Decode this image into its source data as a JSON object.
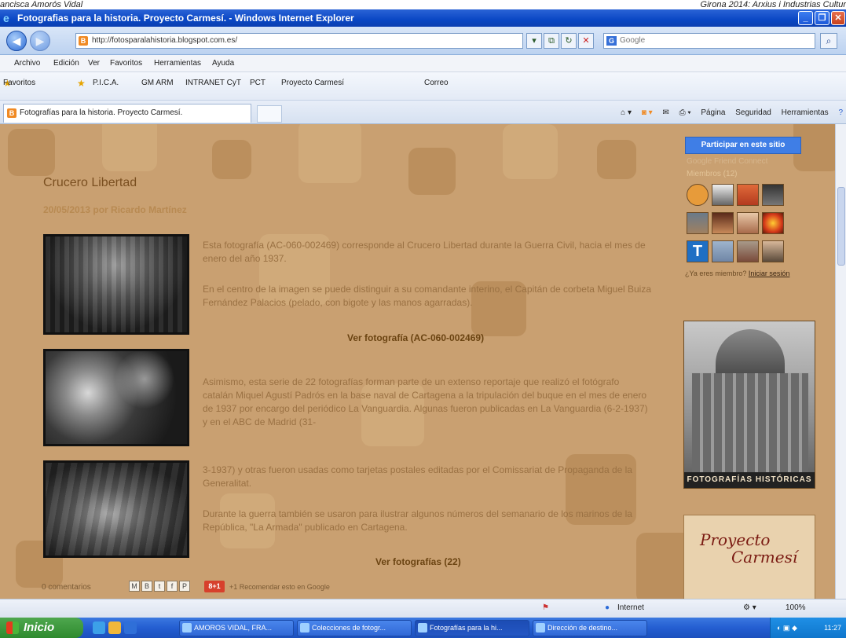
{
  "caption": {
    "left": "ancisca Amorós Vidal",
    "right": "Girona 2014: Arxius i Industrias Cultur"
  },
  "window": {
    "title": "Fotografias para la historia. Proyecto Carmesí. - Windows Internet Explorer"
  },
  "address": {
    "url": "http://fotosparalahistoria.blogspot.com.es/",
    "search_placeholder": "Google"
  },
  "menu": [
    "Archivo",
    "Edición",
    "Ver",
    "Favoritos",
    "Herramientas",
    "Ayuda"
  ],
  "favorites": {
    "label": "Favoritos",
    "items": [
      "P.I.C.A.",
      "GM ARM",
      "INTRANET CyT",
      "PCT",
      "Proyecto Carmesí",
      "Correo"
    ]
  },
  "tab": {
    "label": "Fotografías para la historia. Proyecto Carmesí."
  },
  "commandbar": [
    "Página",
    "Seguridad",
    "Herramientas"
  ],
  "post": {
    "title": "Crucero Libertad",
    "meta": "20/05/2013 por Ricardo Martínez",
    "para1": "Esta fotografía (AC-060-002469) corresponde al Crucero Libertad durante la Guerra Civil, hacia el mes de enero del año 1937.",
    "para2": "En el centro de la imagen se puede distinguir a su comandante interino, el Capitán de corbeta Miguel Buiza Fernández Palacios (pelado, con bigote y las manos agarradas).",
    "link1": "Ver fotografía (AC-060-002469)",
    "para3": "Asimismo, esta serie de 22 fotografías forman parte de un extenso reportaje que realizó el fotógrafo catalán Miquel Agustí Padrós en la base naval de Cartagena a la tripulación del buque en el mes de enero de 1937 por encargo del periódico La Vanguardia. Algunas fueron publicadas en La Vanguardia (6-2-1937) y en el ABC de Madrid (31-",
    "para4": "3-1937) y otras fueron usadas como tarjetas postales editadas por el Comissariat de Propaganda de la Generalitat.",
    "para5": "Durante la guerra también se usaron para ilustrar algunos números del semanario de los marinos de la República, \"La Armada\" publicado en Cartagena.",
    "link2": "Ver fotografías (22)",
    "comments": "0 comentarios",
    "gplus": "8+1",
    "recommend": "+1   Recomendar esto en Google"
  },
  "sidebar": {
    "join_button": "Participar en este sitio",
    "faded1": "Google Friend Connect",
    "members": "Miembros (12)",
    "member_prompt": "¿Ya eres miembro?",
    "login": "Iniciar sesión",
    "photos_caption": "FOTOGRAFÍAS HISTÓRICAS",
    "logo_text1": "Proyecto",
    "logo_text2": "Carmesí"
  },
  "status": {
    "zone": "Internet",
    "zoom": "100%"
  },
  "taskbar": {
    "start": "Inicio",
    "tasks": [
      "AMOROS VIDAL, FRA...",
      "Colecciones de fotogr...",
      "Fotografías para la hi...",
      "Dirección de destino..."
    ],
    "clock": "11:27"
  },
  "colors": {
    "page_bg": "#c9a071",
    "ie_blue": "#0a47c4",
    "join_blue": "#3f7ee6"
  }
}
